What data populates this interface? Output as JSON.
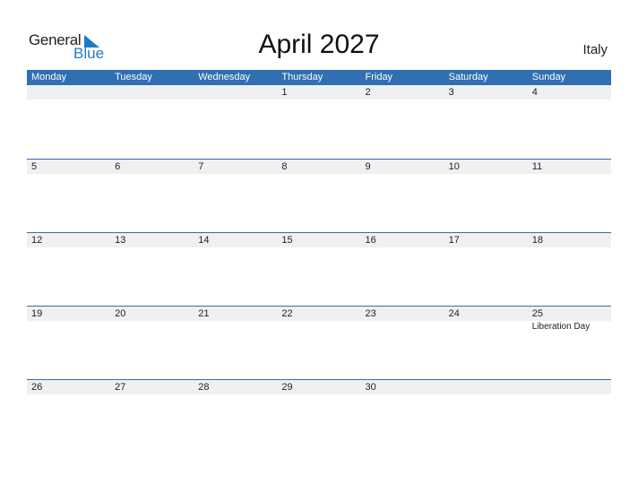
{
  "brand": {
    "general": "General",
    "blue": "Blue"
  },
  "title": "April 2027",
  "country": "Italy",
  "weekdays": [
    "Monday",
    "Tuesday",
    "Wednesday",
    "Thursday",
    "Friday",
    "Saturday",
    "Sunday"
  ],
  "weeks": [
    {
      "days": [
        "",
        "",
        "",
        "1",
        "2",
        "3",
        "4"
      ],
      "events": [
        "",
        "",
        "",
        "",
        "",
        "",
        ""
      ]
    },
    {
      "days": [
        "5",
        "6",
        "7",
        "8",
        "9",
        "10",
        "11"
      ],
      "events": [
        "",
        "",
        "",
        "",
        "",
        "",
        ""
      ]
    },
    {
      "days": [
        "12",
        "13",
        "14",
        "15",
        "16",
        "17",
        "18"
      ],
      "events": [
        "",
        "",
        "",
        "",
        "",
        "",
        ""
      ]
    },
    {
      "days": [
        "19",
        "20",
        "21",
        "22",
        "23",
        "24",
        "25"
      ],
      "events": [
        "",
        "",
        "",
        "",
        "",
        "",
        "Liberation Day"
      ]
    },
    {
      "days": [
        "26",
        "27",
        "28",
        "29",
        "30",
        "",
        ""
      ],
      "events": [
        "",
        "",
        "",
        "",
        "",
        "",
        ""
      ]
    }
  ]
}
